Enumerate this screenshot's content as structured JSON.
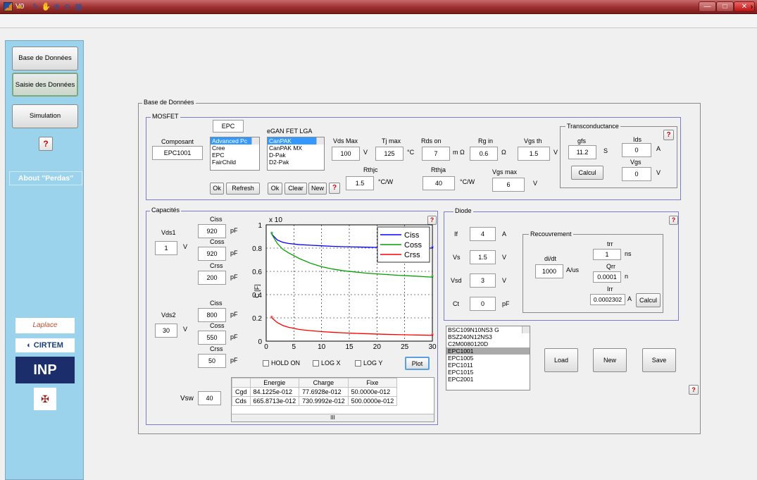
{
  "window": {
    "title": "V0",
    "minimize": "—",
    "maximize": "□",
    "close": "✕"
  },
  "sidebar": {
    "items": [
      "Base de Données",
      "Saisie des Données",
      "Simulation"
    ],
    "help": "?",
    "about": "About \"Perdas\"",
    "logos": [
      "Laplace",
      "CIRTEM",
      "INP",
      "Université de Toulouse"
    ]
  },
  "main": {
    "frame_title": "Base de Données"
  },
  "mosfet": {
    "title": "MOSFET",
    "help": "?",
    "epc_label": "EPC",
    "composant_label": "Composant",
    "composant_value": "EPC1001",
    "manufacturers": [
      "Advanced Pc",
      "Cree",
      "EPC",
      "FairChild"
    ],
    "egan_label": "eGAN FET LGA",
    "packages": [
      "CanPAK",
      "CanPAK MX",
      "D-Pak",
      "D2-Pak"
    ],
    "buttons": {
      "ok1": "Ok",
      "refresh": "Refresh",
      "ok2": "Ok",
      "clear": "Clear",
      "new": "New"
    },
    "params": [
      {
        "label": "Vds Max",
        "value": "100",
        "unit": "V"
      },
      {
        "label": "Tj max",
        "value": "125",
        "unit": "°C"
      },
      {
        "label": "Rds on",
        "value": "7",
        "unit": "m Ω"
      },
      {
        "label": "Rg in",
        "value": "0.6",
        "unit": "Ω"
      },
      {
        "label": "Vgs th",
        "value": "1.5",
        "unit": "V"
      }
    ],
    "rthjc": {
      "label": "Rthjc",
      "value": "1.5",
      "unit": "°C/W"
    },
    "rthja": {
      "label": "Rthja",
      "value": "40",
      "unit": "°C/W"
    },
    "vgsmax": {
      "label": "Vgs max",
      "value": "6",
      "unit": "V"
    },
    "trans": {
      "title": "Transconductance",
      "help": "?",
      "gfs_label": "gfs",
      "gfs_value": "11.2",
      "gfs_unit": "S",
      "ids_label": "Ids",
      "ids_value": "0",
      "ids_unit": "A",
      "vgs_label": "Vgs",
      "vgs_value": "0",
      "vgs_unit": "V",
      "calc": "Calcul"
    }
  },
  "cap": {
    "title": "Capacités",
    "help": "?",
    "vds1": {
      "label": "Vds1",
      "value": "1",
      "unit": "V"
    },
    "vds2": {
      "label": "Vds2",
      "value": "30",
      "unit": "V"
    },
    "set1": [
      {
        "label": "Ciss",
        "value": "920",
        "unit": "pF"
      },
      {
        "label": "Coss",
        "value": "920",
        "unit": "pF"
      },
      {
        "label": "Crss",
        "value": "200",
        "unit": "pF"
      }
    ],
    "set2": [
      {
        "label": "Ciss",
        "value": "800",
        "unit": "pF"
      },
      {
        "label": "Coss",
        "value": "550",
        "pF": "",
        "unit": "pF"
      },
      {
        "label": "Crss",
        "value": "50",
        "unit": "pF"
      }
    ],
    "vsw": {
      "label": "Vsw",
      "value": "40"
    },
    "checks": {
      "hold": "HOLD ON",
      "logx": "LOG X",
      "logy": "LOG Y"
    },
    "plot": "Plot",
    "table": {
      "headers": [
        "",
        "Energie",
        "Charge",
        "Fixe"
      ],
      "rows": [
        [
          "Cgd",
          "84.1225e-012",
          "77.6928e-012",
          "50.0000e-012"
        ],
        [
          "Cds",
          "665.8713e-012",
          "730.9992e-012",
          "500.0000e-012"
        ]
      ]
    },
    "scroll_mark": "III"
  },
  "chart_data": {
    "type": "line",
    "ylabel": "C [F]",
    "xlim": [
      0,
      30
    ],
    "ylim": [
      0,
      1
    ],
    "exponent": "x 10",
    "xticks": [
      "0",
      "5",
      "10",
      "15",
      "20",
      "25",
      "30"
    ],
    "yticks": [
      "0",
      "0.2",
      "0.4",
      "0.6",
      "0.8",
      "1"
    ],
    "grid": true,
    "legend": "top-right",
    "x": [
      1,
      2,
      3,
      4,
      6,
      8,
      10,
      12,
      14,
      16,
      18,
      20,
      22,
      24,
      26,
      28,
      30
    ],
    "series": [
      {
        "name": "Ciss",
        "color": "#0000ff",
        "values": [
          0.92,
          0.87,
          0.85,
          0.84,
          0.83,
          0.825,
          0.82,
          0.815,
          0.812,
          0.81,
          0.808,
          0.806,
          0.805,
          0.803,
          0.802,
          0.801,
          0.8
        ]
      },
      {
        "name": "Coss",
        "color": "#00a000",
        "values": [
          0.92,
          0.84,
          0.79,
          0.76,
          0.71,
          0.67,
          0.64,
          0.62,
          0.605,
          0.595,
          0.585,
          0.578,
          0.572,
          0.566,
          0.561,
          0.556,
          0.55
        ]
      },
      {
        "name": "Crss",
        "color": "#ff0000",
        "values": [
          0.2,
          0.16,
          0.135,
          0.12,
          0.1,
          0.09,
          0.082,
          0.076,
          0.071,
          0.067,
          0.064,
          0.061,
          0.058,
          0.056,
          0.054,
          0.052,
          0.05
        ]
      }
    ]
  },
  "diode": {
    "title": "Diode",
    "help": "?",
    "if": {
      "label": "If",
      "value": "4",
      "unit": "A"
    },
    "vs": {
      "label": "Vs",
      "value": "1.5",
      "unit": "V"
    },
    "vsd": {
      "label": "Vsd",
      "value": "3",
      "unit": "V"
    },
    "ct": {
      "label": "Ct",
      "value": "0",
      "unit": "pF"
    },
    "recouv": {
      "title": "Recouvrement",
      "didt_label": "di/dt",
      "didt_value": "1000",
      "didt_unit": "A/us",
      "trr_label": "trr",
      "trr_value": "1",
      "trr_unit": "ns",
      "qrr_label": "Qrr",
      "qrr_value": "0.0001",
      "qrr_unit": "n",
      "irr_label": "Irr",
      "irr_value": "0.0002302",
      "irr_unit": "A",
      "calc": "Calcul"
    }
  },
  "db": {
    "list": [
      "BSC109N10NS3 G",
      "BSZ240N12NS3",
      "C2M0080120D",
      "EPC1001",
      "EPC1005",
      "EPC1011",
      "EPC1015",
      "EPC2001"
    ],
    "selected": "EPC1001",
    "load": "Load",
    "new": "New",
    "save": "Save",
    "help": "?"
  }
}
